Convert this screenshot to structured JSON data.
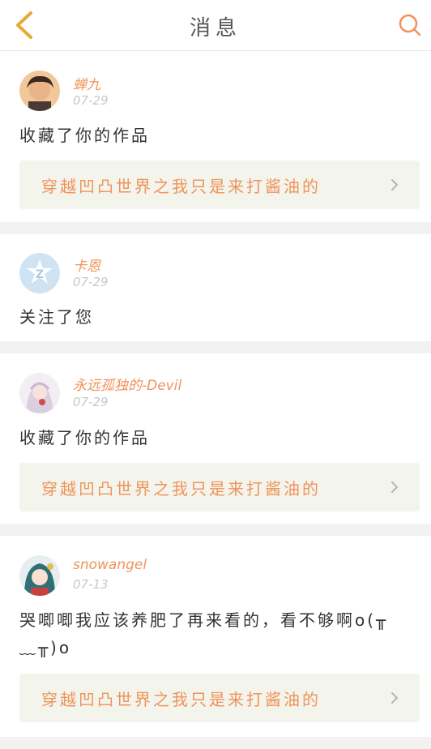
{
  "header": {
    "title": "消息",
    "back_icon": "chevron-left-icon",
    "search_icon": "search-icon",
    "accent_color": "#f0935a"
  },
  "messages": [
    {
      "username": "蝉九",
      "date": "07-29",
      "content": "收藏了你的作品",
      "work_title": "穿越凹凸世界之我只是来打酱油的"
    },
    {
      "username": "卡恩",
      "date": "07-29",
      "content": "关注了您"
    },
    {
      "username": "永远孤独的-Devil",
      "date": "07-29",
      "content": "收藏了你的作品",
      "work_title": "穿越凹凸世界之我只是来打酱油的"
    },
    {
      "username": "snowangel",
      "date": "07-13",
      "content": "哭唧唧我应该养肥了再来看的，看不够啊o(╥﹏╥)o",
      "work_title": "穿越凹凸世界之我只是来打酱油的"
    }
  ]
}
